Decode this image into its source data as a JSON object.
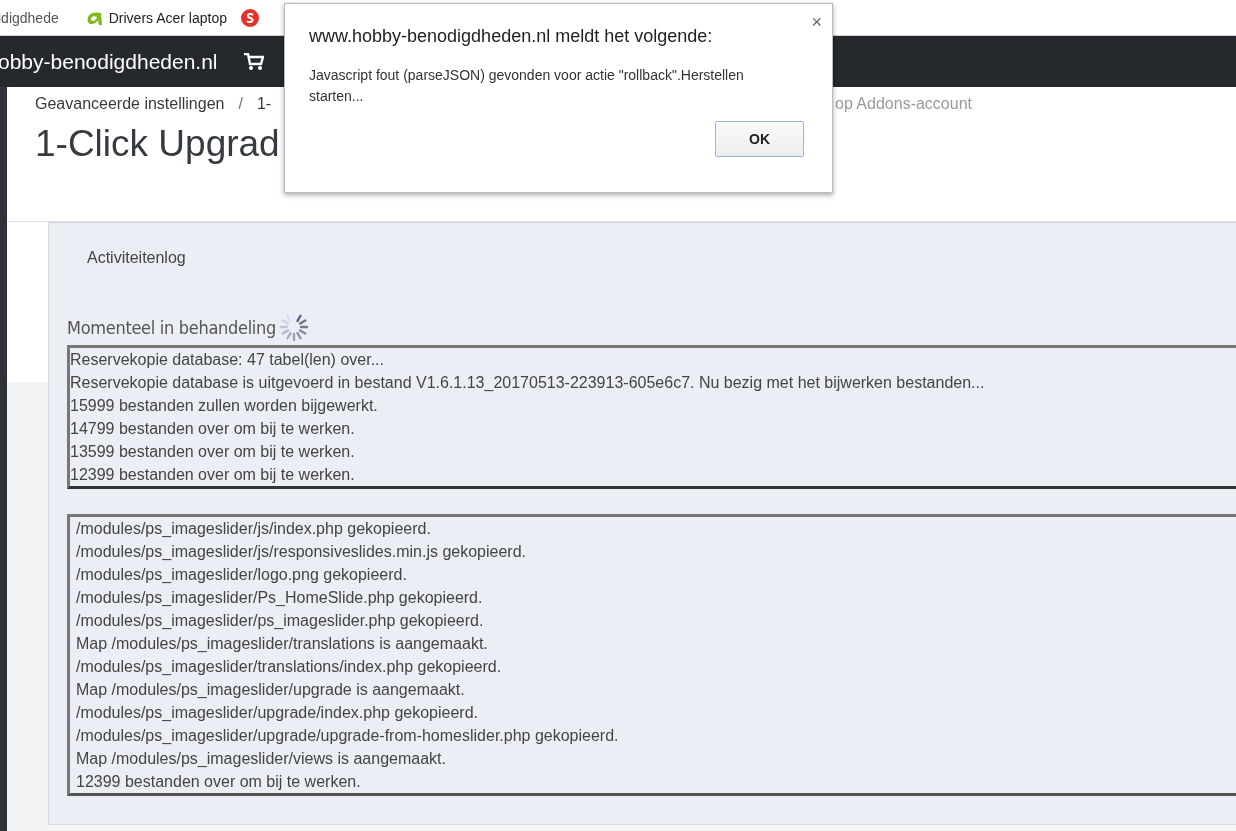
{
  "bookmarks": [
    {
      "kind": "plain",
      "label": "idigdhede"
    },
    {
      "kind": "swoosh",
      "label": "Drivers Acer laptop"
    },
    {
      "kind": "badge"
    }
  ],
  "topbar": {
    "shop_name": "obby-benodigdheden.nl"
  },
  "breadcrumb": {
    "items": [
      "Geavanceerde instellingen",
      "1-"
    ],
    "separator": "/"
  },
  "header_link": "op Addons-account",
  "page_title": "1-Click Upgrad",
  "panel": {
    "tab": "Activiteitenlog",
    "current_title": "Momenteel in behandeling",
    "busy": true,
    "logs": [
      [
        "Reservekopie database: 47 tabel(len) over...",
        "Reservekopie database is uitgevoerd in bestand V1.6.1.13_20170513-223913-605e6c7. Nu bezig met het bijwerken bestanden...",
        "15999 bestanden zullen worden bijgewerkt.",
        "14799 bestanden over om bij te werken.",
        "13599 bestanden over om bij te werken.",
        "12399 bestanden over om bij te werken."
      ],
      [
        "/modules/ps_imageslider/js/index.php gekopieerd.",
        "/modules/ps_imageslider/js/responsiveslides.min.js gekopieerd.",
        "/modules/ps_imageslider/logo.png gekopieerd.",
        "/modules/ps_imageslider/Ps_HomeSlide.php gekopieerd.",
        "/modules/ps_imageslider/ps_imageslider.php gekopieerd.",
        "Map /modules/ps_imageslider/translations is aangemaakt.",
        "/modules/ps_imageslider/translations/index.php gekopieerd.",
        "Map /modules/ps_imageslider/upgrade is aangemaakt.",
        "/modules/ps_imageslider/upgrade/index.php gekopieerd.",
        "/modules/ps_imageslider/upgrade/upgrade-from-homeslider.php gekopieerd.",
        "Map /modules/ps_imageslider/views is aangemaakt.",
        "12399 bestanden over om bij te werken."
      ]
    ]
  },
  "dialog": {
    "title": "www.hobby-benodigdheden.nl meldt het volgende:",
    "message": "Javascript fout (parseJSON) gevonden voor actie \"rollback\".Herstellen starten...",
    "close": "×",
    "button": "OK"
  }
}
